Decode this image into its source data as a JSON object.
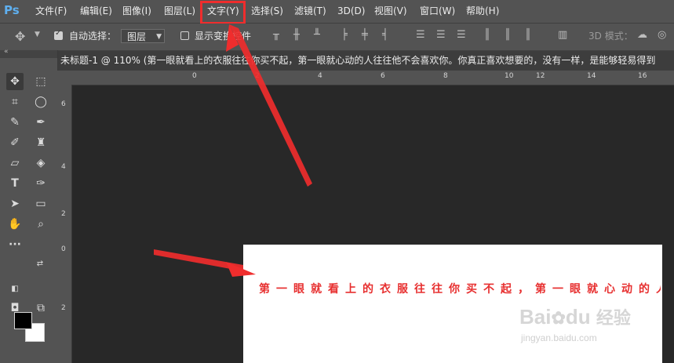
{
  "app": {
    "logo": "Ps"
  },
  "menubar": {
    "items": [
      "文件(F)",
      "编辑(E)",
      "图像(I)",
      "图层(L)",
      "文字(Y)",
      "选择(S)",
      "滤镜(T)",
      "3D(D)",
      "视图(V)",
      "窗口(W)",
      "帮助(H)"
    ],
    "highlighted": "文字(Y)"
  },
  "options_bar": {
    "auto_select_label": "自动选择：",
    "auto_select_checked": true,
    "layer_select_value": "图层",
    "show_transform_label": "显示变换控件",
    "show_transform_checked": false,
    "mode_3d_label": "3D 模式："
  },
  "document": {
    "tab_title": "未标题-1 @ 110% (第一眼就看上的衣服往往你买不起，第一眼就心动的人往往他不会喜欢你。你真正喜欢想要的，没有一样，是能够轻易得到",
    "text_content": "第一眼就看上的衣服往往你买不起，第一眼就心动的人往往他不会喜欢你。",
    "text_color": "#e72f2f"
  },
  "rulers": {
    "top": [
      "0",
      "2",
      "4",
      "6",
      "8",
      "10",
      "12",
      "14",
      "16"
    ],
    "left": [
      "6",
      "4",
      "2",
      "0",
      "2"
    ]
  },
  "watermark": {
    "brand": "Bai",
    "brand2": "du",
    "brand_cn": "经验",
    "url": "jingyan.baidu.com"
  },
  "colors": {
    "annotation_red": "#ef2d2d",
    "foreground": "#000000",
    "background": "#ffffff"
  }
}
